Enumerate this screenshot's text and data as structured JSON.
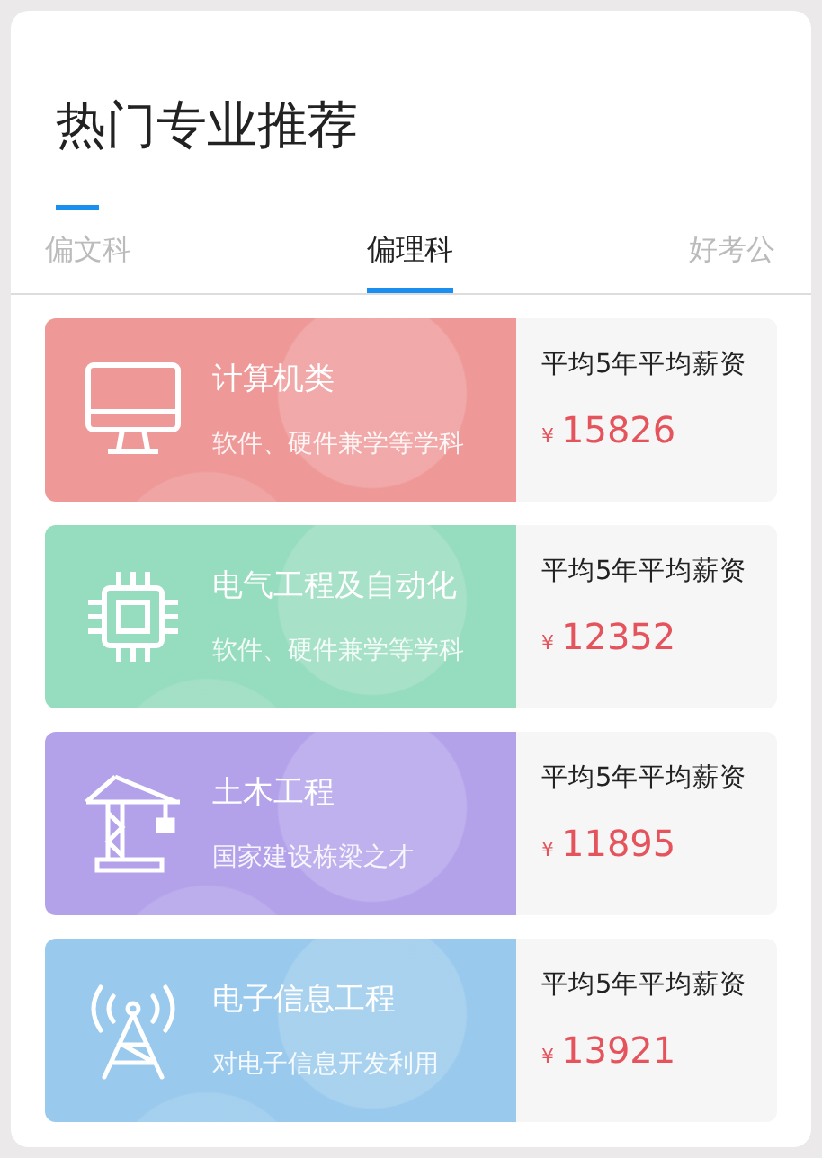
{
  "title": "热门专业推荐",
  "tabs": [
    {
      "label": "偏文科",
      "selected": false
    },
    {
      "label": "偏理科",
      "selected": true
    },
    {
      "label": "好考公",
      "selected": false
    }
  ],
  "majors": [
    {
      "name": "计算机类",
      "description": "软件、硬件兼学等学科",
      "color": "#ee9898",
      "salary_label": "平均5年平均薪资",
      "currency": "¥",
      "salary": "15826"
    },
    {
      "name": "电气工程及自动化",
      "description": "软件、硬件兼学等学科",
      "color": "#96dcbe",
      "salary_label": "平均5年平均薪资",
      "currency": "¥",
      "salary": "12352"
    },
    {
      "name": "土木工程",
      "description": "国家建设栋梁之才",
      "color": "#b3a2ea",
      "salary_label": "平均5年平均薪资",
      "currency": "¥",
      "salary": "11895"
    },
    {
      "name": "电子信息工程",
      "description": "对电子信息开发利用",
      "color": "#99c9ec",
      "salary_label": "平均5年平均薪资",
      "currency": "¥",
      "salary": "13921"
    }
  ]
}
